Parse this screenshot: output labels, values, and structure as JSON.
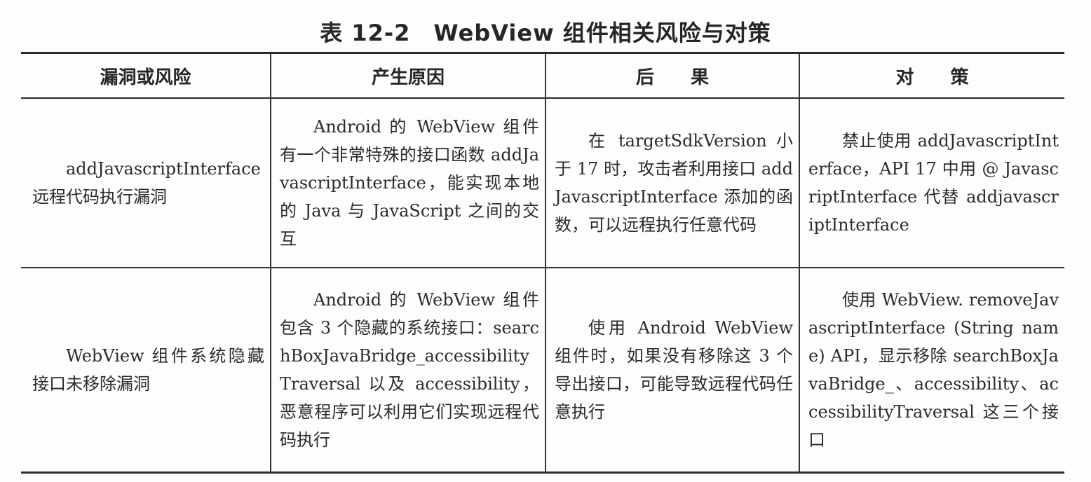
{
  "caption": "表 12-2　WebView 组件相关风险与对策",
  "table": {
    "headers": [
      "漏洞或风险",
      "产生原因",
      "后　　果",
      "对　　策"
    ],
    "rows": [
      {
        "vulnerability": "addJavascriptInterface 远程代码执行漏洞",
        "cause": "Android 的 WebView 组件有一个非常特殊的接口函数 addJavascriptInterface，能实现本地的 Java 与 JavaScript 之间的交互",
        "consequence": "在 targetSdkVersion 小于 17 时，攻击者利用接口 addJavascriptInterface 添加的函数，可以远程执行任意代码",
        "countermeasure": "禁止使用 addJavascriptInterface，API 17 中用 @ JavascriptInterface 代替 addjavascriptInterface"
      },
      {
        "vulnerability": "WebView 组件系统隐藏接口未移除漏洞",
        "cause": "Android 的 WebView 组件包含 3 个隐藏的系统接口：searchBoxJavaBridge_accessibility Traversal 以及 accessibility，恶意程序可以利用它们实现远程代码执行",
        "consequence": "使用 Android WebView 组件时，如果没有移除这 3 个导出接口，可能导致远程代码任意执行",
        "countermeasure": "使用 WebView. removeJavascriptInterface (String name) API，显示移除 searchBoxJavaBridge_、accessibility、accessibilityTraversal 这三个接口"
      }
    ]
  }
}
